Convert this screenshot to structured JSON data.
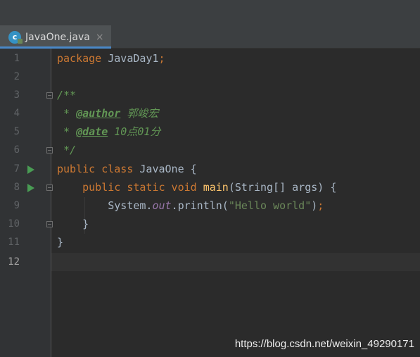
{
  "editor": {
    "tab": {
      "icon": "java-class-icon",
      "label": "JavaOne.java",
      "close": "×"
    }
  },
  "gutter": {
    "line_numbers": [
      "1",
      "2",
      "3",
      "4",
      "5",
      "6",
      "7",
      "8",
      "9",
      "10",
      "11",
      "12"
    ]
  },
  "code": {
    "l1": {
      "kw": "package",
      "rest": " JavaDay1",
      "semi": ";"
    },
    "l3": "/**",
    "l4": {
      "prefix": " * ",
      "tag": "@author",
      "text": " 郭峻宏"
    },
    "l5": {
      "prefix": " * ",
      "tag": "@date",
      "text": " 10点01分"
    },
    "l6": " */",
    "l7": {
      "kw": "public class",
      "rest": " JavaOne {"
    },
    "l8": {
      "indent": "    ",
      "kw": "public static void",
      "sp": " ",
      "fn": "main",
      "rest": "(String[] args) {"
    },
    "l9": {
      "indent": "        ",
      "a": "System.",
      "fld": "out",
      "b": ".println(",
      "str": "\"Hello world\"",
      "c": ")",
      "semi": ";"
    },
    "l10": "    }",
    "l11": "}"
  },
  "watermark": "https://blog.csdn.net/weixin_49290171",
  "colors": {
    "keyword": "#CC7832",
    "string": "#6A8759",
    "doc": "#629755",
    "method": "#FFC66D",
    "field": "#9876AA"
  }
}
